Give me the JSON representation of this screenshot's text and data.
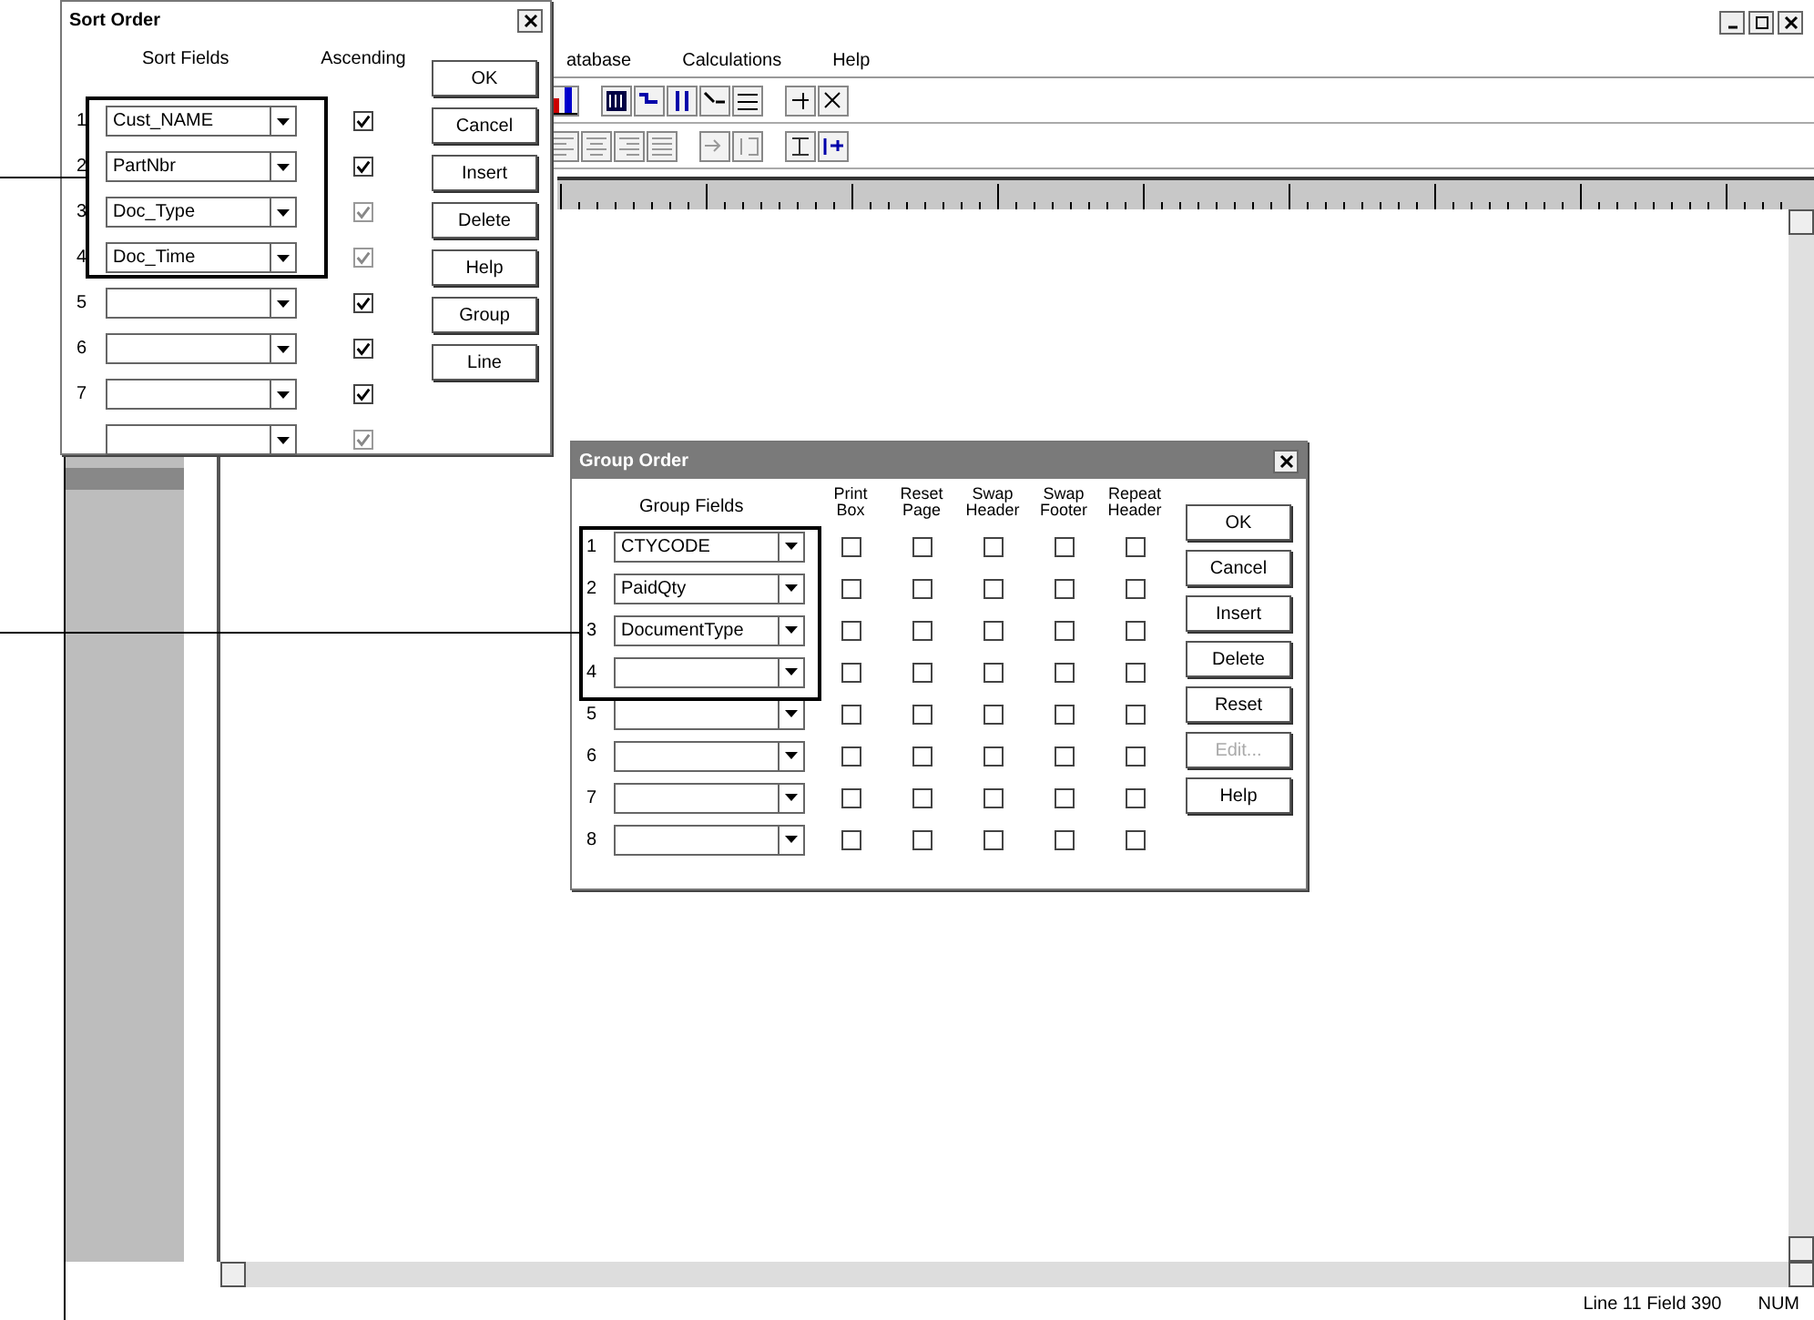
{
  "app": {
    "menu": [
      "atabase",
      "Calculations",
      "Help"
    ],
    "status": [
      "Line 11 Field 390",
      "NUM"
    ]
  },
  "sort_dialog": {
    "title": "Sort Order",
    "columns": [
      "Sort Fields",
      "Ascending"
    ],
    "rows": [
      {
        "number": "1",
        "field": "Cust_NAME",
        "ascending": true,
        "disabled": false
      },
      {
        "number": "2",
        "field": "PartNbr",
        "ascending": true,
        "disabled": false
      },
      {
        "number": "3",
        "field": "Doc_Type",
        "ascending": true,
        "disabled": true
      },
      {
        "number": "4",
        "field": "Doc_Time",
        "ascending": true,
        "disabled": true
      },
      {
        "number": "5",
        "field": "",
        "ascending": true,
        "disabled": false
      },
      {
        "number": "6",
        "field": "",
        "ascending": true,
        "disabled": false
      },
      {
        "number": "7",
        "field": "",
        "ascending": true,
        "disabled": false
      },
      {
        "field": "",
        "ascending": true,
        "disabled": true
      }
    ],
    "buttons": [
      {
        "label": "OK",
        "disabled": false
      },
      {
        "label": "Cancel",
        "disabled": false
      },
      {
        "label": "Insert",
        "disabled": false
      },
      {
        "label": "Delete",
        "disabled": false
      },
      {
        "label": "Help",
        "disabled": false
      },
      {
        "label": "Group",
        "disabled": false
      },
      {
        "label": "Line",
        "disabled": false
      }
    ]
  },
  "group_dialog": {
    "title": "Group Order",
    "field_column": "Group Fields",
    "columns": [
      "Print Box",
      "Reset Page",
      "Swap Header",
      "Swap Footer",
      "Repeat Header"
    ],
    "rows": [
      {
        "number": "1",
        "field": "CTYCODE",
        "checks": [
          false,
          false,
          false,
          false,
          false
        ]
      },
      {
        "number": "2",
        "field": "PaidQty",
        "checks": [
          false,
          false,
          false,
          false,
          false
        ]
      },
      {
        "number": "3",
        "field": "DocumentType",
        "checks": [
          false,
          false,
          false,
          false,
          false
        ]
      },
      {
        "number": "4",
        "field": "",
        "checks": [
          false,
          false,
          false,
          false,
          false
        ]
      },
      {
        "number": "5",
        "field": "",
        "checks": [
          false,
          false,
          false,
          false,
          false
        ]
      },
      {
        "number": "6",
        "field": "",
        "checks": [
          false,
          false,
          false,
          false,
          false
        ]
      },
      {
        "number": "7",
        "field": "",
        "checks": [
          false,
          false,
          false,
          false,
          false
        ]
      },
      {
        "number": "8",
        "field": "",
        "checks": [
          false,
          false,
          false,
          false,
          false
        ]
      }
    ],
    "buttons": [
      {
        "label": "OK",
        "disabled": false
      },
      {
        "label": "Cancel",
        "disabled": false
      },
      {
        "label": "Insert",
        "disabled": false
      },
      {
        "label": "Delete",
        "disabled": false
      },
      {
        "label": "Reset",
        "disabled": false
      },
      {
        "label": "Edit...",
        "disabled": true
      },
      {
        "label": "Help",
        "disabled": false
      }
    ]
  }
}
